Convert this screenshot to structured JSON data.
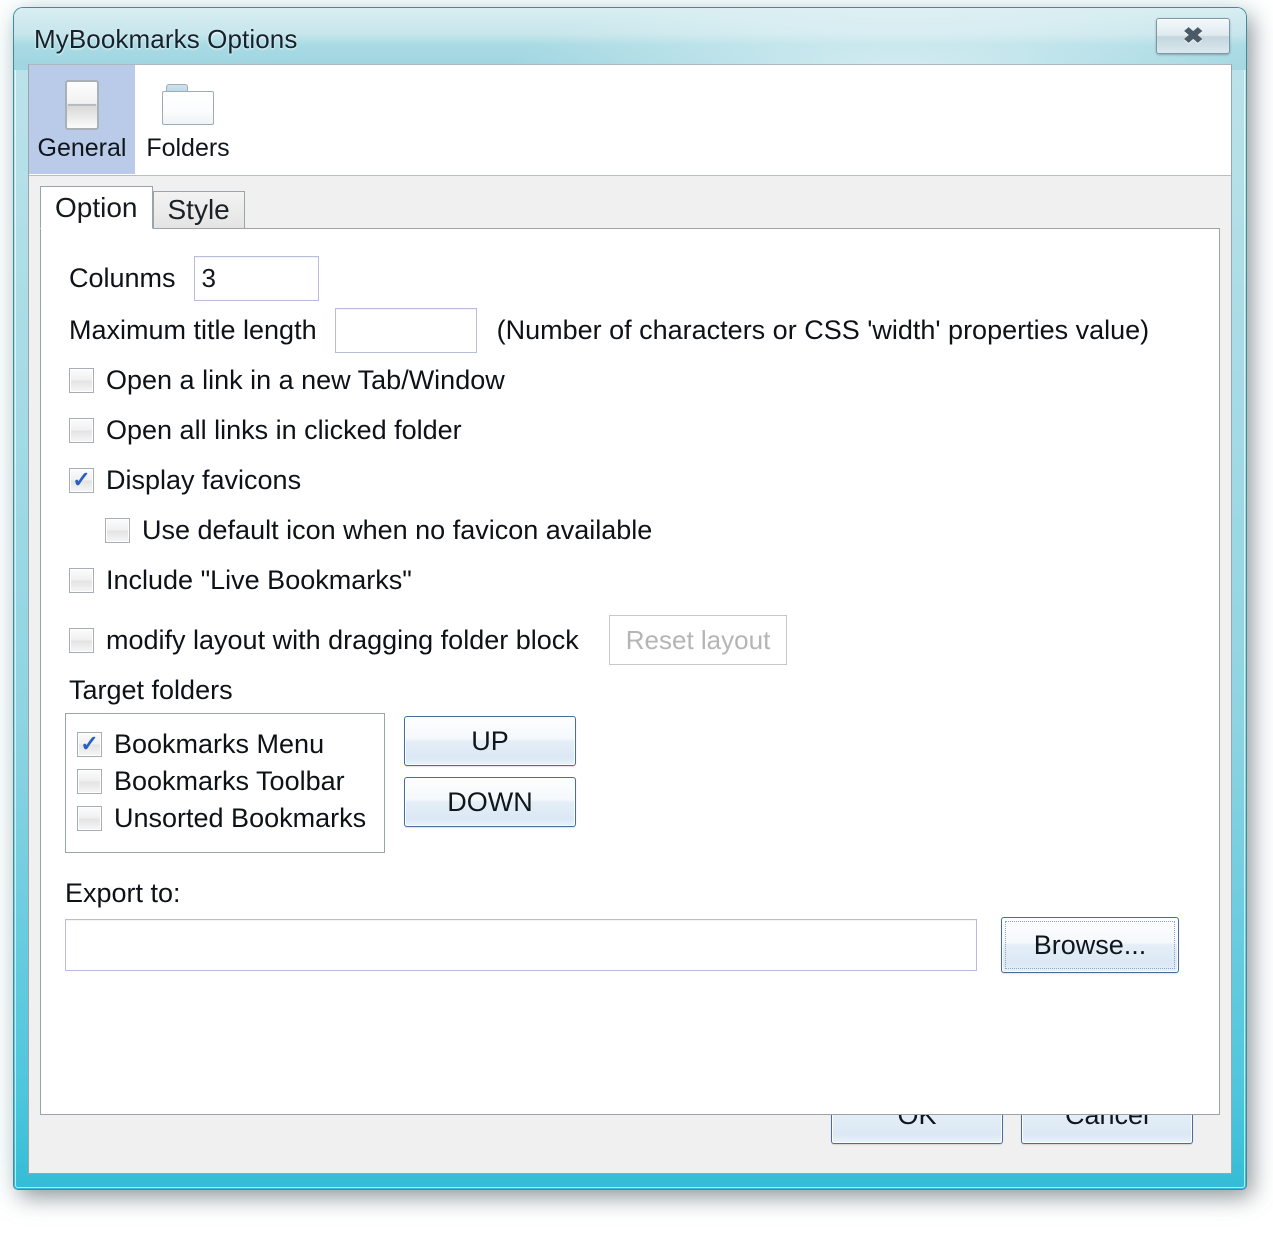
{
  "window": {
    "title": "MyBookmarks Options",
    "close_label": "✖",
    "close_icon": "close-icon"
  },
  "icon_tabs": [
    {
      "label": "General",
      "icon": "switch-icon",
      "selected": true
    },
    {
      "label": "Folders",
      "icon": "folder-icon",
      "selected": false
    }
  ],
  "sub_tabs": [
    {
      "label": "Option",
      "selected": true
    },
    {
      "label": "Style",
      "selected": false
    }
  ],
  "options": {
    "columns": {
      "label": "Colunms",
      "value": "3",
      "placeholder": ""
    },
    "max_title_length": {
      "label": "Maximum title length",
      "value": "",
      "placeholder": "",
      "hint": "(Number of characters or CSS 'width' properties value)"
    },
    "checkboxes": [
      {
        "label": "Open a link in a new Tab/Window",
        "checked": false,
        "indented": false
      },
      {
        "label": "Open all links in clicked folder",
        "checked": false,
        "indented": false
      },
      {
        "label": "Display favicons",
        "checked": true,
        "indented": false
      },
      {
        "label": "Use default icon when no favicon available",
        "checked": false,
        "indented": true
      },
      {
        "label": "Include \"Live Bookmarks\"",
        "checked": false,
        "indented": false
      }
    ],
    "modify_layout": {
      "label": "modify layout with dragging folder block",
      "checked": false
    },
    "reset_layout_button": {
      "label": "Reset layout",
      "disabled": true
    }
  },
  "target_folders": {
    "group_label": "Target folders",
    "items": [
      {
        "label": "Bookmarks Menu",
        "checked": true
      },
      {
        "label": "Bookmarks Toolbar",
        "checked": false
      },
      {
        "label": "Unsorted Bookmarks",
        "checked": false
      }
    ],
    "up_button": "UP",
    "down_button": "DOWN"
  },
  "export": {
    "label": "Export to:",
    "value": "",
    "placeholder": "",
    "browse_button": "Browse..."
  },
  "dialog_buttons": {
    "ok": "OK",
    "cancel": "Cancel"
  },
  "colors": {
    "frame_cyan": "#4ec6dd",
    "titlebar_top": "#d8eef2",
    "selected_tab": "#b9cbe8",
    "check_blue": "#2b5fc4",
    "button_border": "#4a6c9b",
    "input_border": "#b9bcdc",
    "disabled_text": "#b5b5b5"
  }
}
